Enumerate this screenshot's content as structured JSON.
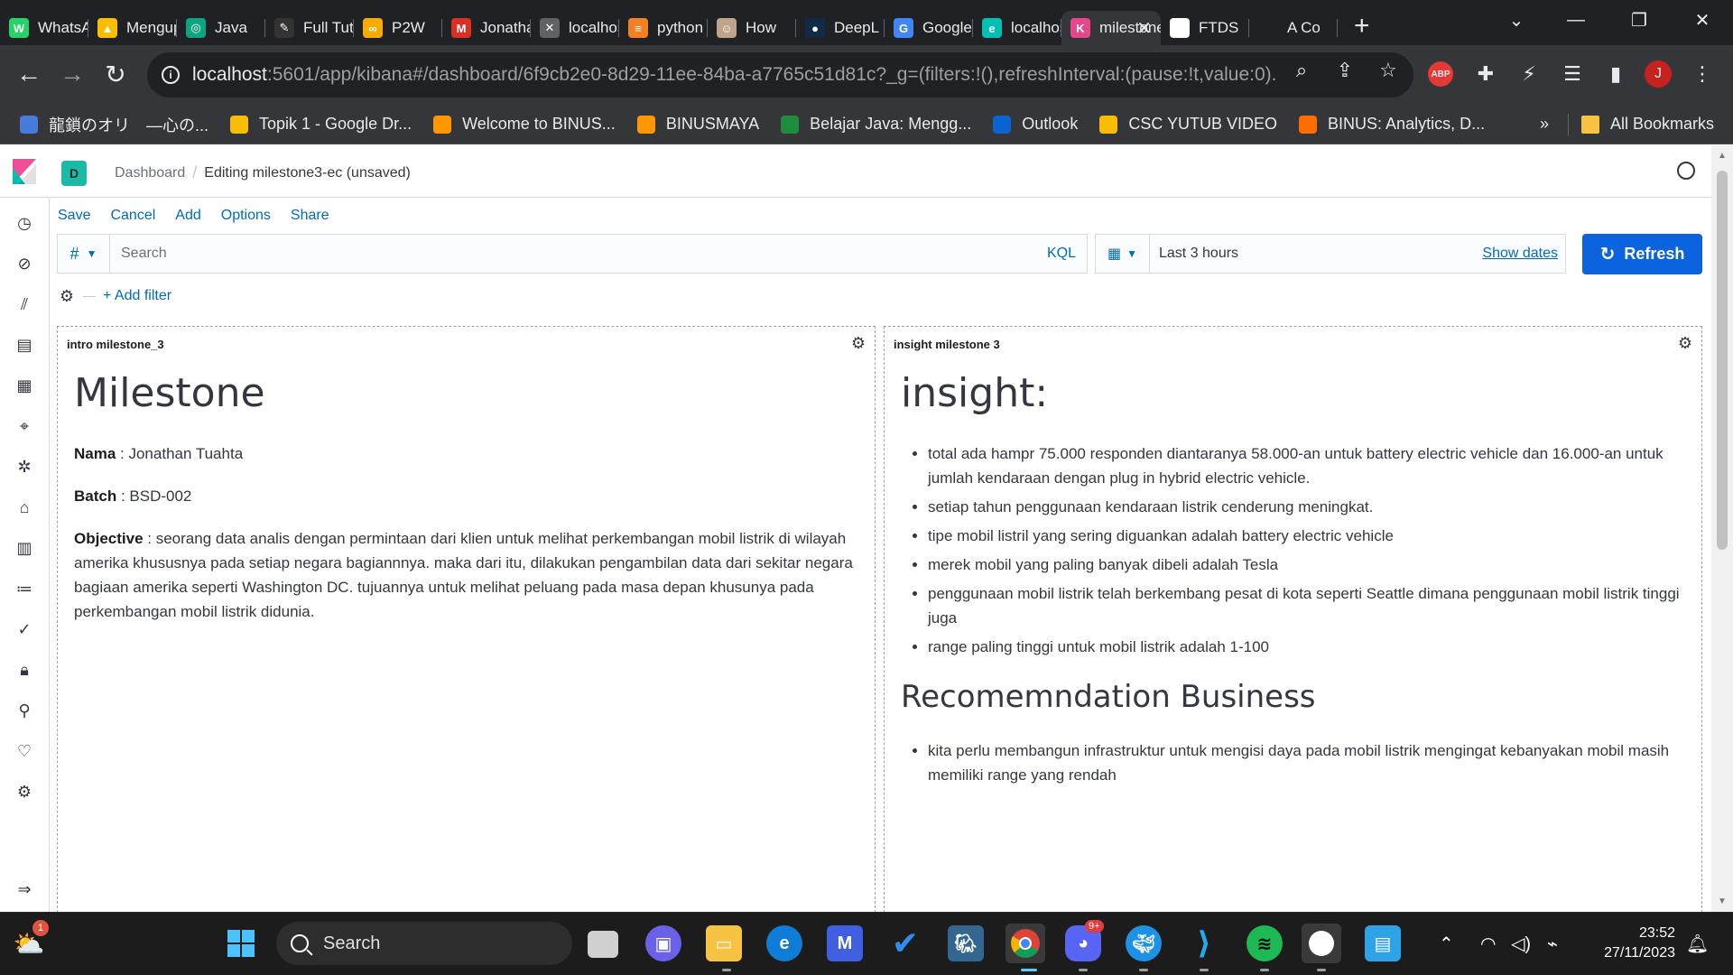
{
  "browser": {
    "tabs": [
      {
        "title": "WhatsApp",
        "color": "#25d366",
        "glyph": "W"
      },
      {
        "title": "Mengupload",
        "color": "#fbbc04",
        "glyph": "▲"
      },
      {
        "title": "Java",
        "color": "#10a37f",
        "glyph": "◎"
      },
      {
        "title": "Full Tutorial",
        "color": "#333333",
        "glyph": "✎"
      },
      {
        "title": "P2W",
        "color": "#f9ab00",
        "glyph": "∞"
      },
      {
        "title": "Jonathan",
        "color": "#d93025",
        "glyph": "M"
      },
      {
        "title": "localhost",
        "color": "#5f6368",
        "glyph": "✕"
      },
      {
        "title": "python",
        "color": "#f48024",
        "glyph": "≡"
      },
      {
        "title": "How",
        "color": "#bfa38a",
        "glyph": "☺"
      },
      {
        "title": "DeepL",
        "color": "#0f2b46",
        "glyph": "●"
      },
      {
        "title": "Google",
        "color": "#4285f4",
        "glyph": "G"
      },
      {
        "title": "localhost",
        "color": "#00bfb3",
        "glyph": "e"
      }
    ],
    "active_tab": {
      "title": "milestone",
      "color": "#e8478b",
      "glyph": "K"
    },
    "tabs_after": [
      {
        "title": "FTDS",
        "color": "#ffffff",
        "glyph": "◉"
      },
      {
        "title": "A Co",
        "color": "#202124",
        "glyph": ""
      }
    ],
    "url_host": "localhost",
    "url_rest": ":5601/app/kibana#/dashboard/6f9cb2e0-8d29-11ee-84ba-a7765c51d81c?_g=(filters:!(),refreshInterval:(pause:!t,value:0)...",
    "profile_initial": "J",
    "bookmarks": [
      {
        "label": "龍鎖のオリ　—心の...",
        "color": "#4a7bd8"
      },
      {
        "label": "Topik 1 - Google Dr...",
        "color": "#fbbc04"
      },
      {
        "label": "Welcome to BINUS...",
        "color": "#ff9800"
      },
      {
        "label": "BINUSMAYA",
        "color": "#ff9800"
      },
      {
        "label": "Belajar Java: Mengg...",
        "color": "#1e8e3e"
      },
      {
        "label": "Outlook",
        "color": "#0a64d1"
      },
      {
        "label": "CSC YUTUB VIDEO",
        "color": "#fbbc04"
      },
      {
        "label": "BINUS: Analytics, D...",
        "color": "#ff6d00"
      }
    ],
    "all_bookmarks_label": "All Bookmarks",
    "more_label": "»"
  },
  "kibana": {
    "space_initial": "D",
    "breadcrumb_root": "Dashboard",
    "breadcrumb_current": "Editing milestone3-ec (unsaved)",
    "menu": {
      "save": "Save",
      "cancel": "Cancel",
      "add": "Add",
      "options": "Options",
      "share": "Share"
    },
    "query": {
      "prefix": "#",
      "placeholder": "Search",
      "language": "KQL"
    },
    "time": {
      "range": "Last 3 hours",
      "show_dates": "Show dates"
    },
    "refresh_label": "Refresh",
    "add_filter_label": "+ Add filter",
    "panels": {
      "intro": {
        "title": "intro milestone_3",
        "heading": "Milestone",
        "nama_label": "Nama",
        "nama_value": " : Jonathan Tuahta",
        "batch_label": "Batch",
        "batch_value": " : BSD-002",
        "objective_label": "Objective",
        "objective_value": " : seorang data analis dengan permintaan dari klien untuk melihat perkembangan mobil listrik di wilayah amerika khususnya pada setiap negara bagiannnya. maka dari itu, dilakukan pengambilan data dari sekitar negara bagiaan amerika seperti Washington DC. tujuannya untuk melihat peluang pada masa depan khusunya pada perkembangan mobil listrik didunia."
      },
      "insight": {
        "title": "insight milestone 3",
        "heading": "insight:",
        "items": [
          "total ada hampr 75.000 responden diantaranya 58.000-an untuk battery electric vehicle dan 16.000-an untuk jumlah kendaraan dengan plug in hybrid electric vehicle.",
          "setiap tahun penggunaan kendaraan listrik cenderung meningkat.",
          "tipe mobil listril yang sering diguankan adalah battery electric vehicle",
          "merek mobil yang paling banyak dibeli adalah Tesla",
          "penggunaan mobil listrik telah berkembang pesat di kota seperti Seattle dimana penggunaan mobil listrik tinggi juga",
          "range paling tinggi untuk mobil listrik adalah 1-100"
        ],
        "rec_heading": "Recomemndation Business",
        "rec_items": [
          "kita perlu membangun infrastruktur untuk mengisi daya pada mobil listrik mengingat kebanyakan mobil masih memiliki range yang rendah"
        ]
      }
    }
  },
  "taskbar": {
    "search_label": "Search",
    "time": "23:52",
    "date": "27/11/2023",
    "discord_badge": "9+",
    "weather_badge": "1"
  }
}
